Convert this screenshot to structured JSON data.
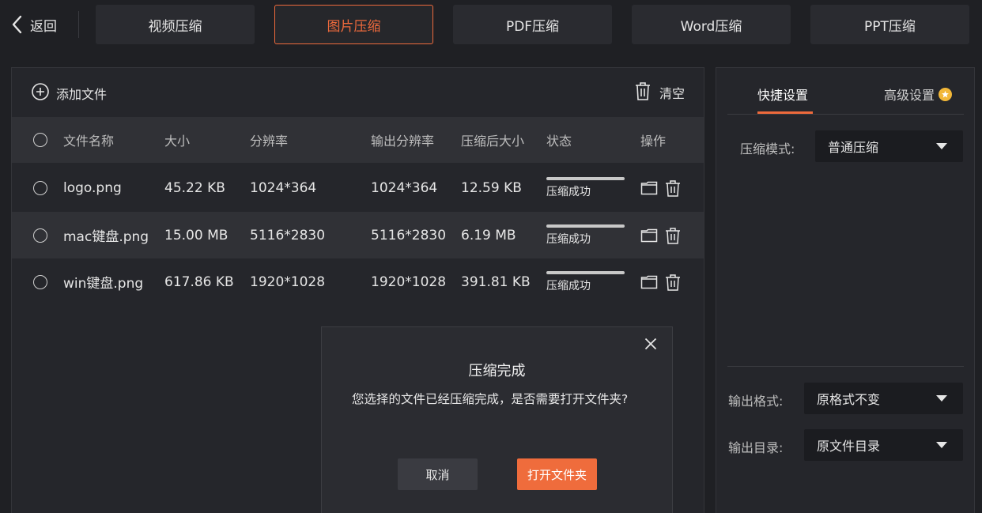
{
  "topbar": {
    "back_label": "返回",
    "tabs": [
      {
        "label": "视频压缩",
        "active": false
      },
      {
        "label": "图片压缩",
        "active": true
      },
      {
        "label": "PDF压缩",
        "active": false
      },
      {
        "label": "Word压缩",
        "active": false
      },
      {
        "label": "PPT压缩",
        "active": false
      }
    ]
  },
  "file_panel": {
    "add_file_label": "添加文件",
    "clear_label": "清空",
    "columns": {
      "name": "文件名称",
      "size": "大小",
      "resolution": "分辨率",
      "output_resolution": "输出分辨率",
      "compressed_size": "压缩后大小",
      "status": "状态",
      "actions": "操作"
    },
    "rows": [
      {
        "name": "logo.png",
        "size": "45.22 KB",
        "resolution": "1024*364",
        "output_resolution": "1024*364",
        "compressed_size": "12.59 KB",
        "status": "压缩成功",
        "progress": 1.0
      },
      {
        "name": "mac键盘.png",
        "size": "15.00 MB",
        "resolution": "5116*2830",
        "output_resolution": "5116*2830",
        "compressed_size": "6.19 MB",
        "status": "压缩成功",
        "progress": 1.0
      },
      {
        "name": "win键盘.png",
        "size": "617.86 KB",
        "resolution": "1920*1028",
        "output_resolution": "1920*1028",
        "compressed_size": "391.81 KB",
        "status": "压缩成功",
        "progress": 1.0
      }
    ]
  },
  "settings": {
    "tab_quick": "快捷设置",
    "tab_advanced": "高级设置",
    "mode_label": "压缩模式:",
    "mode_value": "普通压缩",
    "format_label": "输出格式:",
    "format_value": "原格式不变",
    "dir_label": "输出目录:",
    "dir_value": "原文件目录"
  },
  "dialog": {
    "title": "压缩完成",
    "message": "您选择的文件已经压缩完成，是否需要打开文件夹?",
    "cancel_label": "取消",
    "open_label": "打开文件夹"
  },
  "colors": {
    "accent": "#ee6a3c",
    "badge": "#f2b738",
    "background": "#1f2024"
  }
}
